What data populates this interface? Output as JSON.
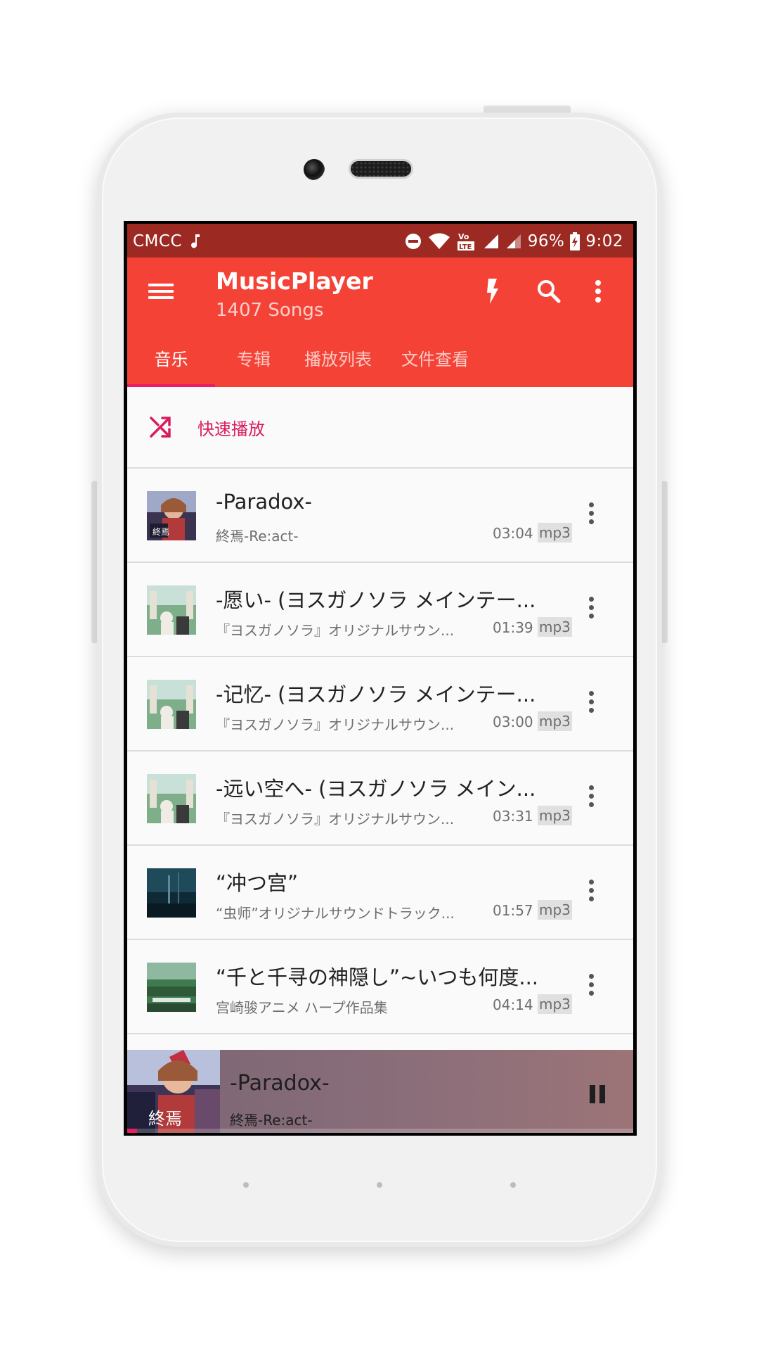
{
  "status_bar": {
    "carrier": "CMCC",
    "battery": "96%",
    "time": "9:02",
    "icons": [
      "music-note-icon",
      "do-not-disturb-icon",
      "wifi-icon",
      "volte-lte-icon",
      "signal-icon",
      "signal-icon-2",
      "battery-charging-icon"
    ]
  },
  "app_bar": {
    "title": "MusicPlayer",
    "subtitle": "1407 Songs",
    "actions": [
      "flash-icon",
      "search-icon",
      "more-vert-icon"
    ]
  },
  "tabs": [
    {
      "label": "音乐",
      "active": true
    },
    {
      "label": "专辑",
      "active": false
    },
    {
      "label": "播放列表",
      "active": false
    },
    {
      "label": "文件查看",
      "active": false
    }
  ],
  "shuffle": {
    "label": "快速播放"
  },
  "songs": [
    {
      "title": "-Paradox-",
      "album": "終焉-Re:act-",
      "duration": "03:04",
      "format": "mp3"
    },
    {
      "title": "-愿い- (ヨスガノソラ メインテー...",
      "album": "『ヨスガノソラ』オリジナルサウン...",
      "duration": "01:39",
      "format": "mp3"
    },
    {
      "title": "-记忆- (ヨスガノソラ メインテー...",
      "album": "『ヨスガノソラ』オリジナルサウン...",
      "duration": "03:00",
      "format": "mp3"
    },
    {
      "title": "-远い空へ- (ヨスガノソラ メイン...",
      "album": "『ヨスガノソラ』オリジナルサウン...",
      "duration": "03:31",
      "format": "mp3"
    },
    {
      "title": "“冲つ宫”",
      "album": "“虫师”オリジナルサウンドトラック...",
      "duration": "01:57",
      "format": "mp3"
    },
    {
      "title": "“千と千寻の神隠し”~いつも何度...",
      "album": "宫崎骏アニメ ハープ作品集",
      "duration": "04:14",
      "format": "mp3"
    }
  ],
  "now_playing": {
    "title": "-Paradox-",
    "album": "終焉-Re:act-",
    "progress": 0.02
  },
  "colors": {
    "status_bar": "#9c2a22",
    "primary": "#f44336",
    "accent": "#e91e63"
  }
}
